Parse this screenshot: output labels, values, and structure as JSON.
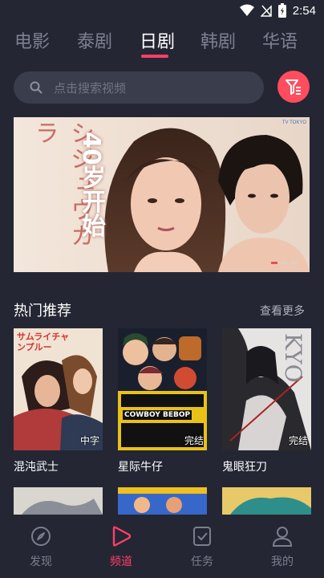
{
  "status_bar": {
    "time": "2:54"
  },
  "tabs": [
    {
      "label": "电影"
    },
    {
      "label": "泰剧"
    },
    {
      "label": "日剧"
    },
    {
      "label": "韩剧"
    },
    {
      "label": "华语"
    }
  ],
  "active_tab": "日剧",
  "search": {
    "placeholder": "点击搜索视频"
  },
  "banner": {
    "vertical_text": "シジュウカラ",
    "title_cn": "40岁开始",
    "logo": "TV TOKYO"
  },
  "section": {
    "title": "热门推荐",
    "more": "查看更多"
  },
  "cards": [
    {
      "title": "混沌武士",
      "badge": "中字",
      "poster_text": "サムライチャンプルー"
    },
    {
      "title": "星际牛仔",
      "badge": "完结",
      "poster_text": "COWBOY BEBOP"
    },
    {
      "title": "鬼眼狂刀",
      "badge": "完结",
      "poster_text": "KYO"
    }
  ],
  "bottom_nav": [
    {
      "label": "发现"
    },
    {
      "label": "频道"
    },
    {
      "label": "任务"
    },
    {
      "label": "我的"
    }
  ],
  "colors": {
    "accent": "#ff3f66",
    "background": "#242633",
    "filter": "#ff4d5e"
  }
}
